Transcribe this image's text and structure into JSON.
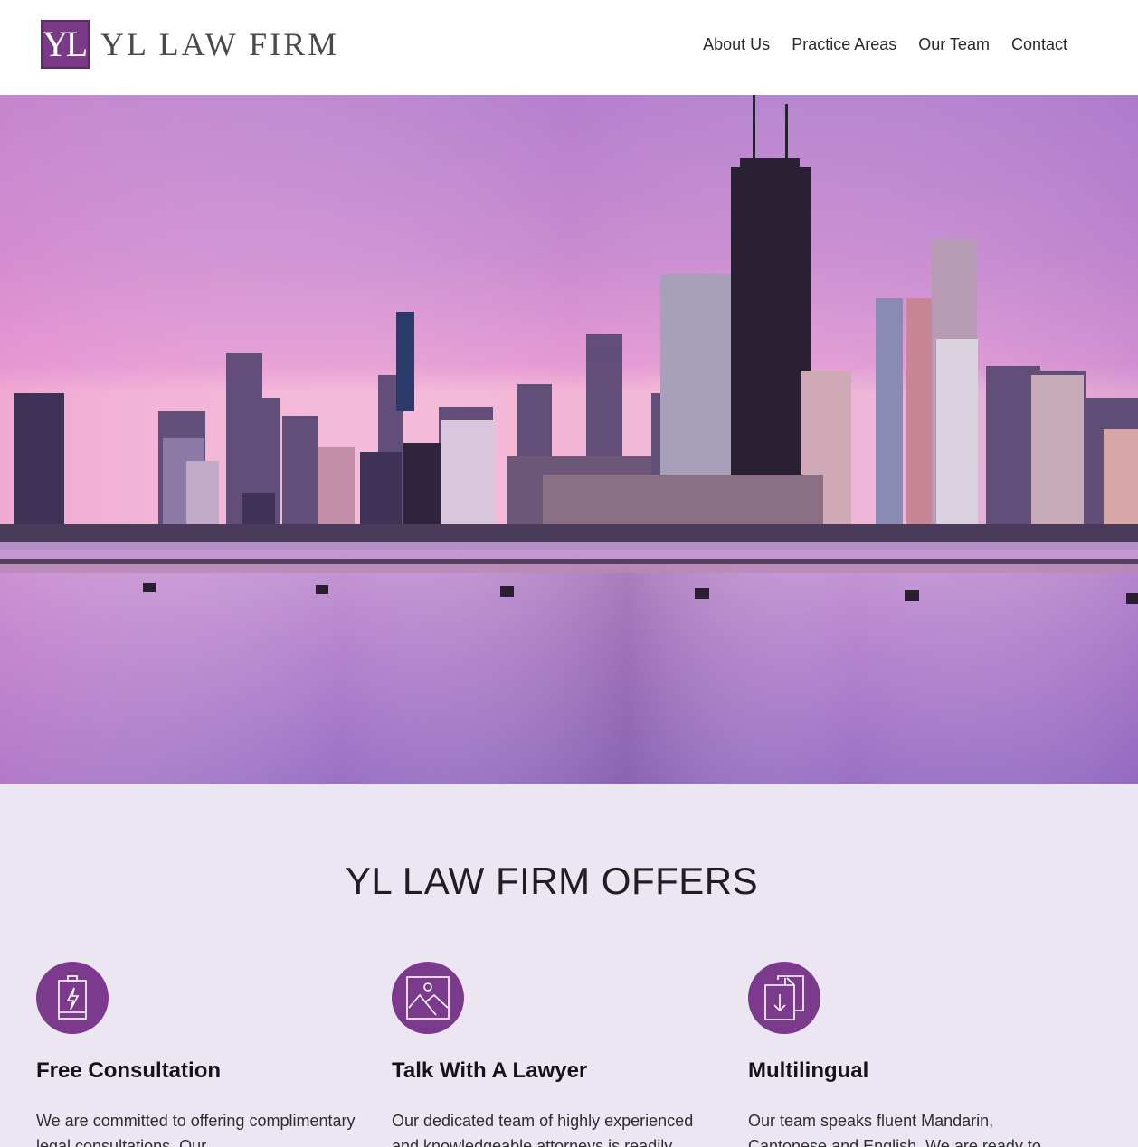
{
  "brand": {
    "mark": "YL",
    "name": "YL LAW FIRM",
    "color": "#7b3a86"
  },
  "nav": {
    "items": [
      {
        "label": "About Us"
      },
      {
        "label": "Practice Areas"
      },
      {
        "label": "Our Team"
      },
      {
        "label": "Contact"
      }
    ]
  },
  "hero": {
    "image": "city-skyline-at-dusk-over-lake",
    "sky_color": "#c98ad0"
  },
  "offers": {
    "title": "YL LAW FIRM OFFERS",
    "background": "#ebe6f1",
    "accent": "#7b3a8c",
    "cards": [
      {
        "icon": "battery-charging-icon",
        "title": "Free Consultation",
        "text": "We are committed to offering complimentary legal consultations. Our"
      },
      {
        "icon": "image-icon",
        "title": "Talk With A Lawyer",
        "text": "Our dedicated team of highly experienced and knowledgeable attorneys is readily"
      },
      {
        "icon": "document-download-icon",
        "title": "Multilingual",
        "text": "Our team speaks fluent Mandarin, Cantonese and English. We are ready to"
      }
    ]
  }
}
